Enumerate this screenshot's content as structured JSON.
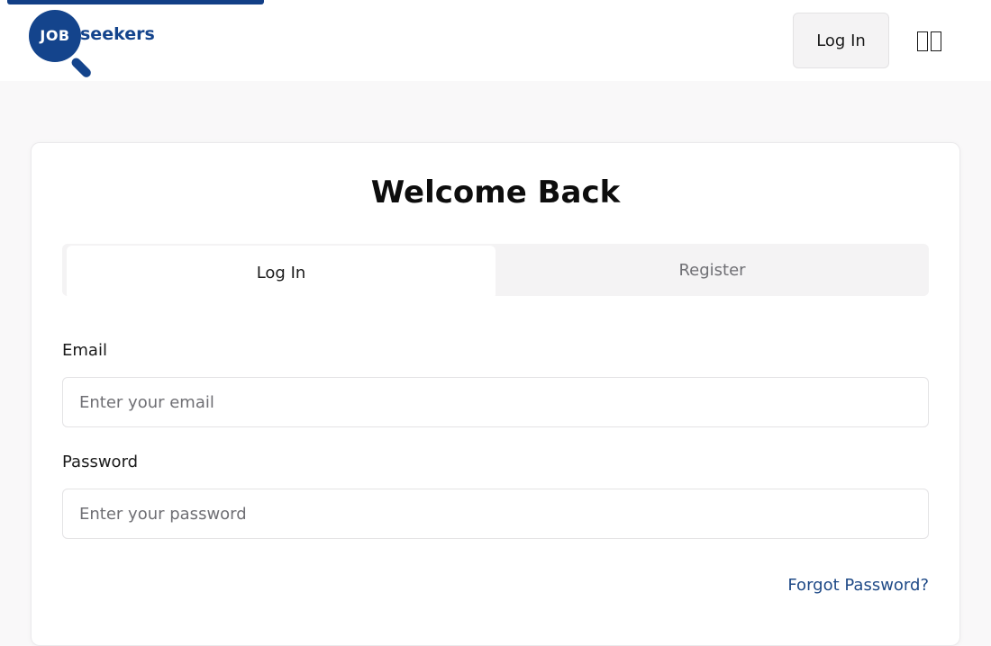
{
  "header": {
    "logo": {
      "badge_text": "JOB",
      "word_text": "seekers"
    },
    "login_button": "Log In",
    "menu_icon": "split-view-icon"
  },
  "card": {
    "title": "Welcome Back",
    "tabs": [
      {
        "label": "Log In",
        "active": true
      },
      {
        "label": "Register",
        "active": false
      }
    ],
    "email": {
      "label": "Email",
      "placeholder": "Enter your email",
      "value": ""
    },
    "password": {
      "label": "Password",
      "placeholder": "Enter your password",
      "value": ""
    },
    "forgot_link": "Forgot Password?"
  },
  "colors": {
    "brand": "#14448c",
    "link": "#1f4a87",
    "page_bg": "#f9f8f9",
    "tab_bg": "#f4f3f4"
  }
}
